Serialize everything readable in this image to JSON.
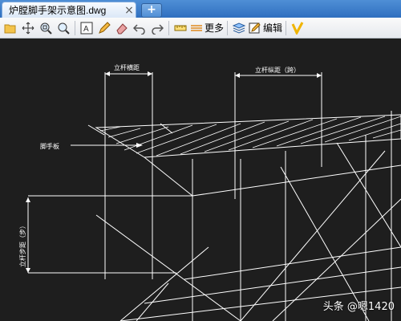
{
  "tab": {
    "title": "炉膛脚手架示意图.dwg",
    "close_icon": "×"
  },
  "new_tab": "+",
  "toolbar": {
    "more_label": "更多",
    "edit_label": "编辑"
  },
  "drawing": {
    "label_transverse": "立杆横距",
    "label_longitudinal": "立杆纵距（跨）",
    "label_board": "脚手板",
    "label_step": "立杆步距（步）"
  },
  "watermark": "头条 @嗯1420"
}
